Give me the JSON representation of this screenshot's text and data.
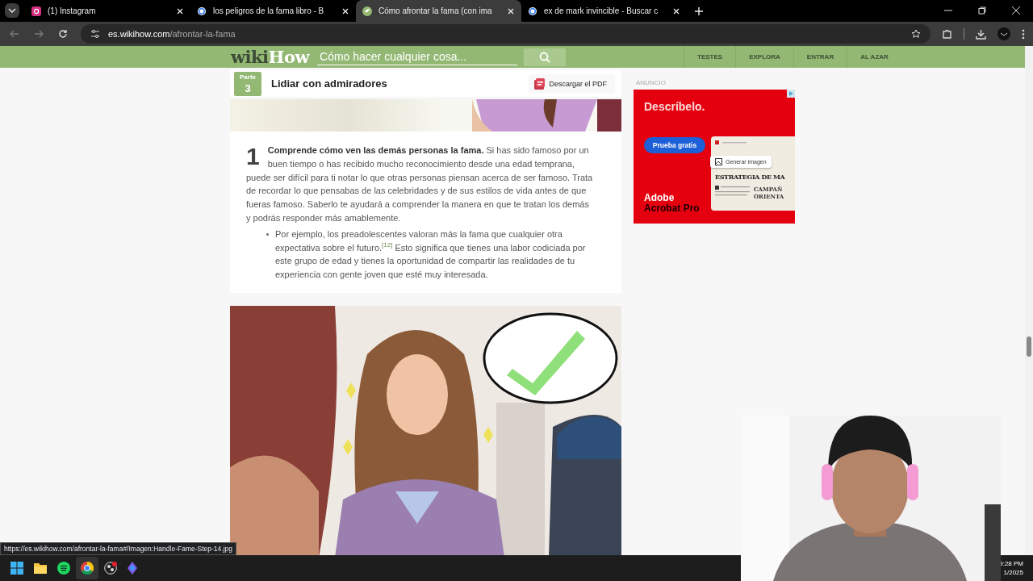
{
  "tabs": [
    {
      "kind": "instagram",
      "title": "(1) Instagram",
      "selected": false
    },
    {
      "kind": "google",
      "title": "los peligros de la fama libro - B",
      "selected": false
    },
    {
      "kind": "wikihow",
      "title": "Cómo afrontar la fama (con ima",
      "selected": true
    },
    {
      "kind": "google",
      "title": "ex de mark invincible - Buscar c",
      "selected": false
    }
  ],
  "address": {
    "domain": "es.wikihow.com",
    "path": "/afrontar-la-fama"
  },
  "header": {
    "logo_wiki": "wiki",
    "logo_how": "How",
    "search_placeholder": "Cómo hacer cualquier cosa...",
    "nav": [
      "TESTES",
      "EXPLORA",
      "ENTRAR",
      "AL AZAR"
    ]
  },
  "section": {
    "part_label": "Parte",
    "part_number": "3",
    "title": "Lidiar con admiradores",
    "pdf_button": "Descargar el PDF"
  },
  "step": {
    "number": "1",
    "text": "**Comprende cómo ven las demás personas la fama.** Si has sido famoso por un buen tiempo o has recibido mucho reconocimiento desde una edad temprana, puede ser difícil para ti notar lo que otras personas piensan acerca de ser famoso. Trata de recordar lo que pensabas de las celebridades y de sus estilos de vida antes de que fueras famoso. Saberlo te ayudará a comprender la manera en que te tratan los demás y podrás responder más amablemente.",
    "bullets": [
      "Por ejemplo, los preadolescentes valoran más la fama que cualquier otra expectativa sobre el futuro.$^{[12]}$ Esto significa que tienes una labor codiciada por este grupo de edad y tienes la oportunidad de compartir las realidades de tu experiencia con gente joven que esté muy interesada."
    ]
  },
  "ad": {
    "label": "ANUNCIO",
    "headline": "Descríbelo.",
    "button": "Prueba gratis",
    "popup": "Generar imagen",
    "doc_title": "ESTRATEGIA DE MA",
    "doc_side": [
      "CAMPAÑ",
      "ORIENTA"
    ],
    "brand": "Adobe",
    "product": "Acrobat Pro"
  },
  "status_url": "https://es.wikihow.com/afrontar-la-fama#/Imagen:Handle-Fame-Step-14.jpg",
  "clock": {
    "time": "9:28 PM",
    "date": "1/2025"
  }
}
